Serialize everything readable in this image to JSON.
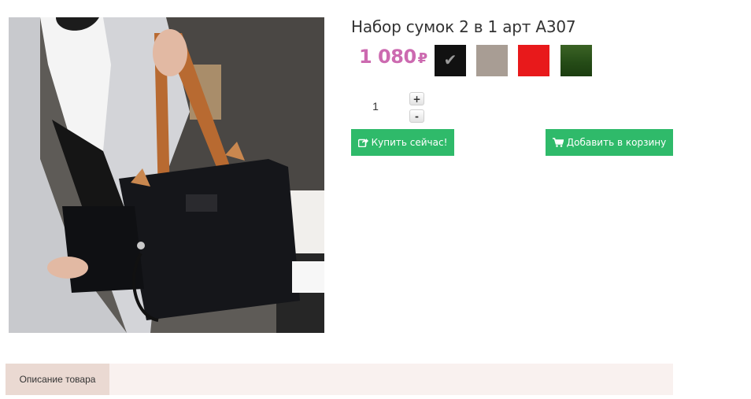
{
  "product": {
    "title": "Набор сумок 2 в 1 арт A307",
    "price": "1 080",
    "currency": "₽",
    "price_color": "#cc6ab0",
    "image_icon": "product-photo-handbag-set",
    "swatches": [
      {
        "color": "#111111",
        "selected": true
      },
      {
        "color": "#a89d94",
        "selected": false
      },
      {
        "color": "#e8191b",
        "selected": false
      },
      {
        "color": "#244a16",
        "selected": false
      }
    ]
  },
  "quantity": {
    "value": "1",
    "plus_label": "+",
    "minus_label": "-"
  },
  "actions": {
    "buy_now_label": "Купить сейчас!",
    "buy_now_icon": "share-icon",
    "add_to_cart_label": "Добавить в корзину",
    "add_to_cart_icon": "cart-icon",
    "button_color": "#2fba6a"
  },
  "tabs": {
    "description_label": "Описание товара"
  }
}
